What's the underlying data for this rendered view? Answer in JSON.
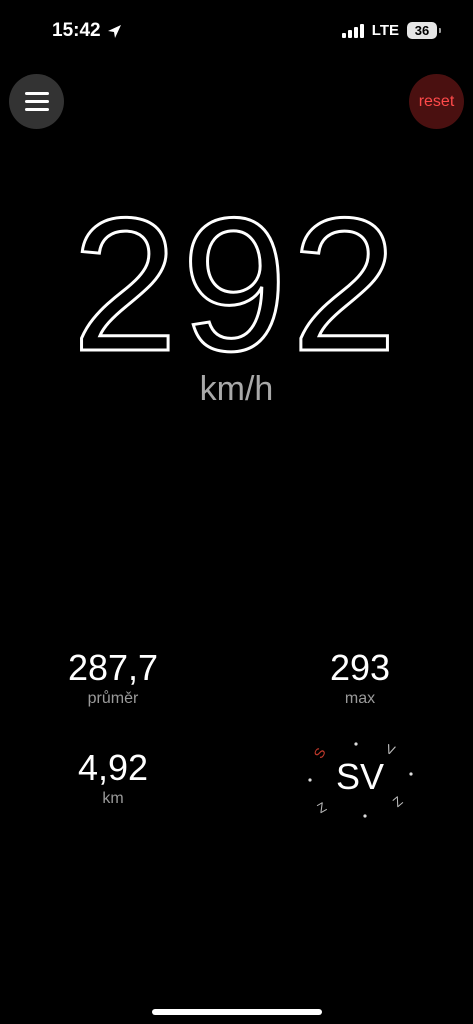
{
  "status_bar": {
    "time": "15:42",
    "network": "LTE",
    "battery": "36"
  },
  "toolbar": {
    "menu_icon": "hamburger-menu-icon",
    "reset_label": "reset",
    "reset_color": "#ff4a4a"
  },
  "speedometer": {
    "speed": "292",
    "unit": "km/h"
  },
  "stats": {
    "average_value": "287,7",
    "average_label": "průměr",
    "max_value": "293",
    "max_label": "max",
    "distance_value": "4,92",
    "distance_label": "km"
  },
  "compass": {
    "heading": "SV",
    "north_marker_color": "#c0392b"
  }
}
